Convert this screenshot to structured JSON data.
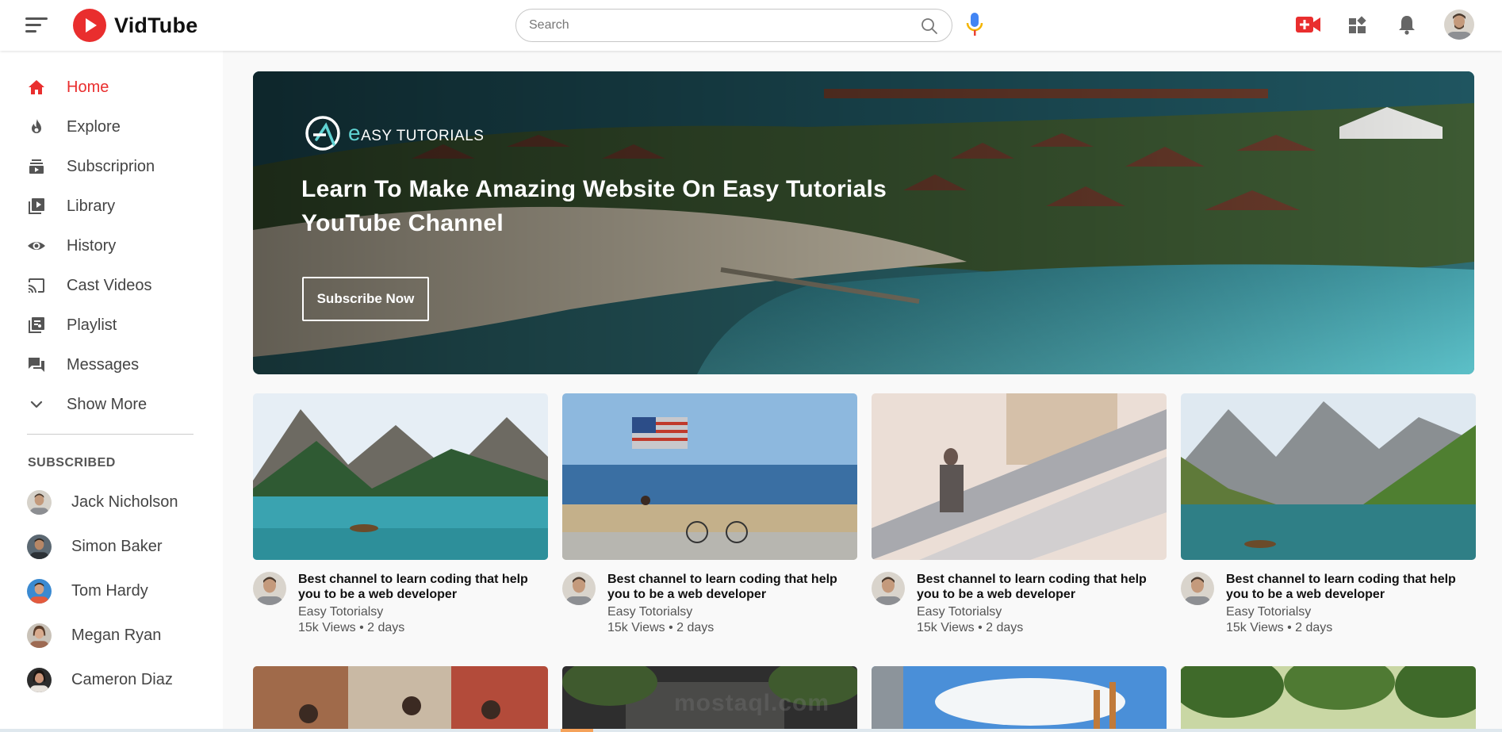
{
  "app": {
    "name": "VidTube"
  },
  "search": {
    "placeholder": "Search",
    "value": ""
  },
  "header_icons": [
    "upload-video-icon",
    "apps-icon",
    "notification-bell-icon",
    "profile-avatar"
  ],
  "sidebar": {
    "items": [
      {
        "label": "Home",
        "icon": "home-icon",
        "active": true
      },
      {
        "label": "Explore",
        "icon": "explore-flame-icon",
        "active": false
      },
      {
        "label": "Subscriprion",
        "icon": "subscriptions-icon",
        "active": false
      },
      {
        "label": "Library",
        "icon": "library-icon",
        "active": false
      },
      {
        "label": "History",
        "icon": "history-eye-icon",
        "active": false
      },
      {
        "label": "Cast Videos",
        "icon": "cast-icon",
        "active": false
      },
      {
        "label": "Playlist",
        "icon": "playlist-icon",
        "active": false
      },
      {
        "label": "Messages",
        "icon": "messages-icon",
        "active": false
      },
      {
        "label": "Show More",
        "icon": "chevron-down-icon",
        "active": false
      }
    ],
    "subscribed_title": "SUBSCRIBED",
    "subscribed": [
      {
        "name": "Jack Nicholson"
      },
      {
        "name": "Simon Baker"
      },
      {
        "name": "Tom Hardy"
      },
      {
        "name": "Megan Ryan"
      },
      {
        "name": "Cameron Diaz"
      }
    ]
  },
  "banner": {
    "logo_e": "e",
    "logo_text": "ASY TUTORIALS",
    "title": "Learn To Make Amazing Website On Easy Tutorials YouTube Channel",
    "button": "Subscribe Now"
  },
  "videos": [
    {
      "title": "Best channel to learn coding that help you to be a web developer",
      "channel": "Easy Totorialsy",
      "meta": "15k Views • 2 days"
    },
    {
      "title": "Best channel to learn coding that help you to be a web developer",
      "channel": "Easy Totorialsy",
      "meta": "15k Views • 2 days"
    },
    {
      "title": "Best channel to learn coding that help you to be a web developer",
      "channel": "Easy Totorialsy",
      "meta": "15k Views • 2 days"
    },
    {
      "title": "Best channel to learn coding that help you to be a web developer",
      "channel": "Easy Totorialsy",
      "meta": "15k Views • 2 days"
    }
  ],
  "watermark": {
    "text": "mostaql.com"
  },
  "colors": {
    "accent": "#e92e2e",
    "banner_teal": "#5fd3d3"
  }
}
